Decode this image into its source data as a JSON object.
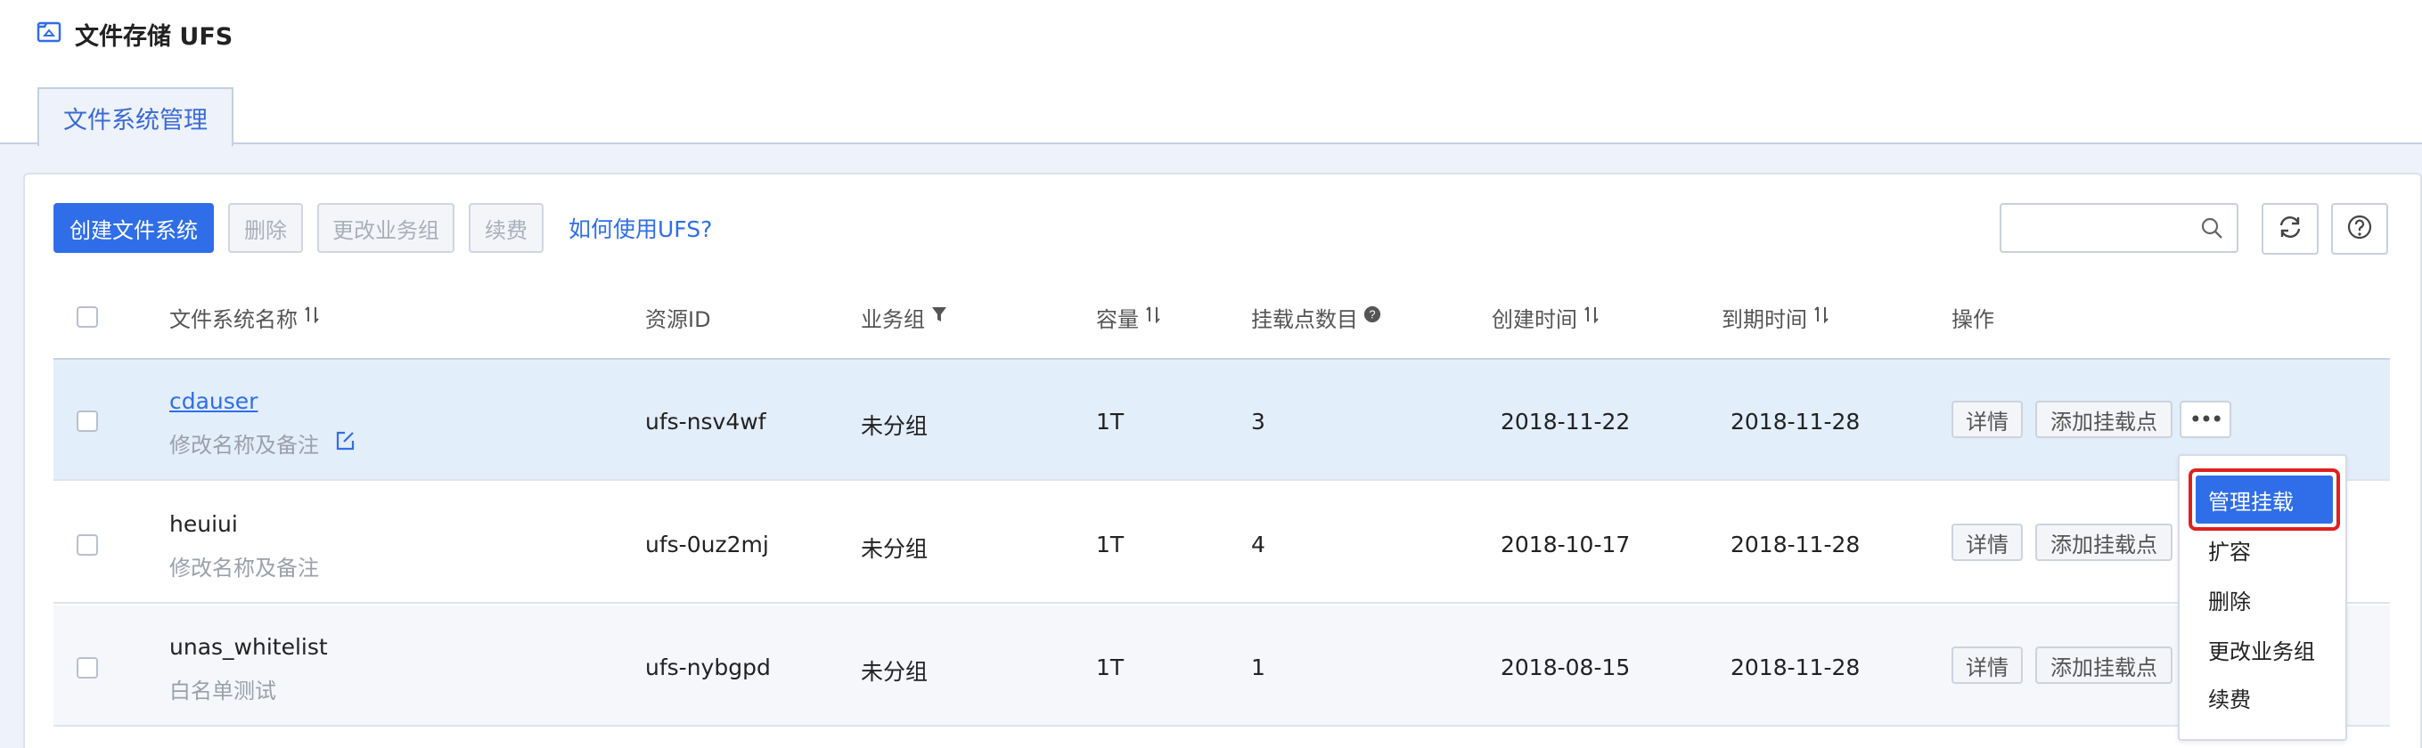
{
  "app": {
    "title": "文件存储 UFS"
  },
  "tabs": [
    {
      "label": "文件系统管理"
    }
  ],
  "toolbar": {
    "create": "创建文件系统",
    "delete": "删除",
    "change_group": "更改业务组",
    "renew": "续费",
    "help_link": "如何使用UFS?",
    "search_placeholder": ""
  },
  "table": {
    "headers": {
      "name": "文件系统名称",
      "resource_id": "资源ID",
      "group": "业务组",
      "capacity": "容量",
      "mount_count": "挂载点数目",
      "created": "创建时间",
      "expires": "到期时间",
      "actions": "操作"
    },
    "rows": [
      {
        "name": "cdauser",
        "note": "修改名称及备注",
        "resource_id": "ufs-nsv4wf",
        "group": "未分组",
        "capacity": "1T",
        "mount_count": "3",
        "created": "2018-11-22",
        "expires": "2018-11-28"
      },
      {
        "name": "heuiui",
        "note": "修改名称及备注",
        "resource_id": "ufs-0uz2mj",
        "group": "未分组",
        "capacity": "1T",
        "mount_count": "4",
        "created": "2018-10-17",
        "expires": "2018-11-28"
      },
      {
        "name": "unas_whitelist",
        "note": "白名单测试",
        "resource_id": "ufs-nybgpd",
        "group": "未分组",
        "capacity": "1T",
        "mount_count": "1",
        "created": "2018-08-15",
        "expires": "2018-11-28"
      }
    ],
    "row_actions": {
      "details": "详情",
      "add_mount": "添加挂载点",
      "more": "•••"
    }
  },
  "dropdown": {
    "items": [
      "管理挂载",
      "扩容",
      "删除",
      "更改业务组",
      "续费"
    ],
    "selected_index": 0
  },
  "colors": {
    "accent": "#2f6ee8",
    "highlight_border": "#e02020",
    "selected_row_bg": "#e3eefb"
  }
}
